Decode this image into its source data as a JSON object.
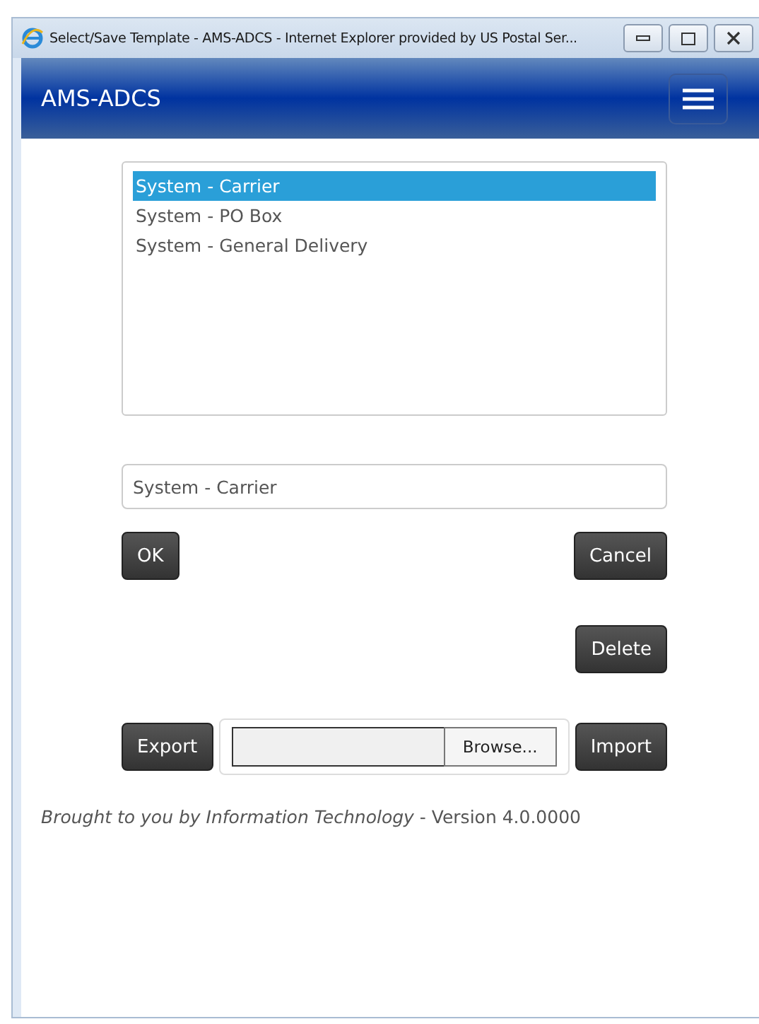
{
  "window": {
    "title": "Select/Save Template - AMS-ADCS - Internet Explorer provided by US Postal Ser..."
  },
  "header": {
    "title": "AMS-ADCS"
  },
  "templates": [
    {
      "label": "System - Carrier",
      "selected": true
    },
    {
      "label": "System - PO Box",
      "selected": false
    },
    {
      "label": "System - General Delivery",
      "selected": false
    }
  ],
  "name_field": {
    "value": "System - Carrier"
  },
  "buttons": {
    "ok": "OK",
    "cancel": "Cancel",
    "delete": "Delete",
    "export": "Export",
    "browse": "Browse...",
    "import": "Import"
  },
  "footer": "*Brought to you by Information Technology* - Version 4.0.0000"
}
